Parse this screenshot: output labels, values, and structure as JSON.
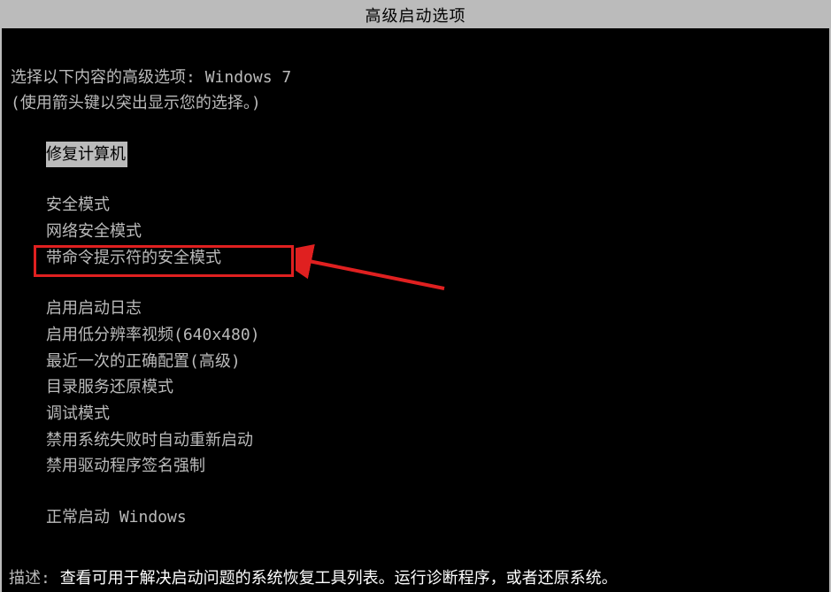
{
  "title": "高级启动选项",
  "intro_line1_prefix": "选择以下内容的高级选项: ",
  "intro_line1_os": "Windows 7",
  "intro_line2": "(使用箭头键以突出显示您的选择。)",
  "repair_prefix_spaces": "    ",
  "options": {
    "repair": "修复计算机",
    "safe_mode": "安全模式",
    "safe_mode_network": "网络安全模式",
    "safe_mode_cmd": "带命令提示符的安全模式",
    "boot_logging": "启用启动日志",
    "low_res": "启用低分辨率视频(640x480)",
    "last_known_good": "最近一次的正确配置(高级)",
    "ds_restore": "目录服务还原模式",
    "debug_mode": "调试模式",
    "disable_auto_restart": "禁用系统失败时自动重新启动",
    "disable_driver_sig": "禁用驱动程序签名强制",
    "start_normally": "正常启动 Windows"
  },
  "description_label": "描述: ",
  "description_text": "查看可用于解决启动问题的系统恢复工具列表。运行诊断程序，或者还原系统。"
}
